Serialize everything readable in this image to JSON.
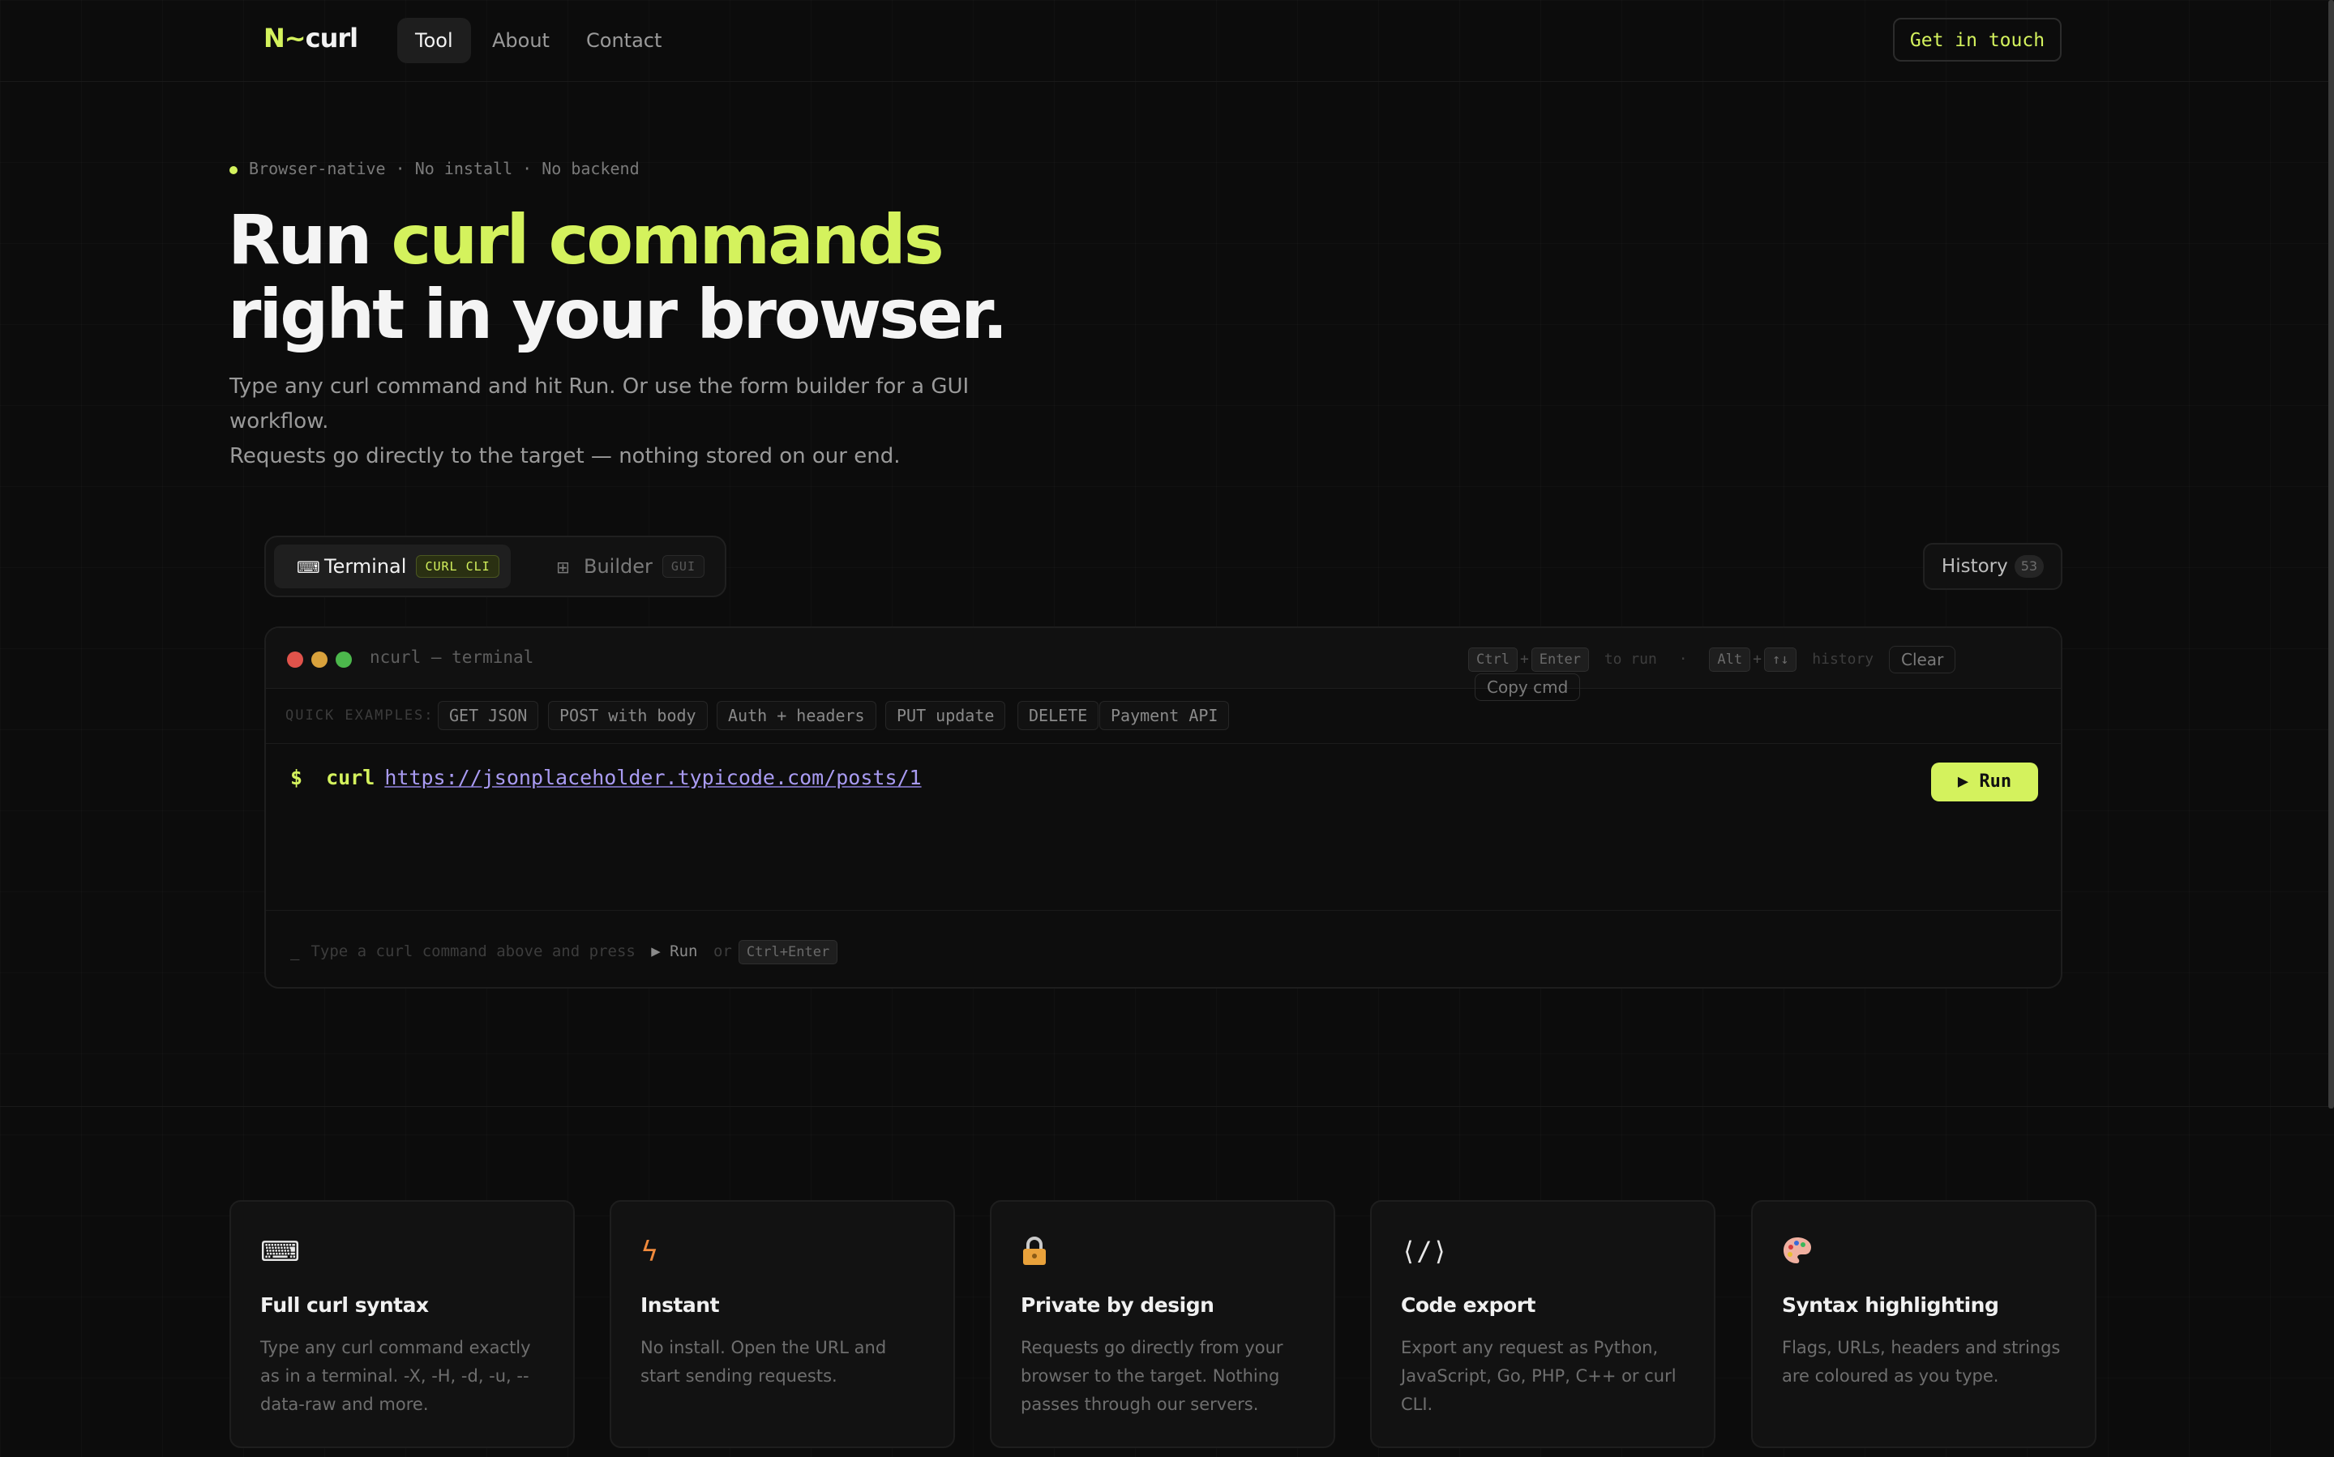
{
  "nav": {
    "logo_prefix": "N~",
    "logo_text": "curl",
    "links": [
      "Tool",
      "About",
      "Contact"
    ],
    "cta": "Get in touch"
  },
  "hero": {
    "tagline": "Browser-native · No install · No backend",
    "title_part1": "Run ",
    "title_highlight": "curl commands",
    "title_part2": "right in your browser.",
    "lead_line1": "Type any curl command and hit Run. Or use the form builder for a GUI workflow.",
    "lead_line2": "Requests go directly to the target — nothing stored on our end."
  },
  "tool": {
    "tabs": [
      {
        "label": "Terminal",
        "badge": "CURL CLI",
        "icon": "keyboard-icon"
      },
      {
        "label": "Builder",
        "badge": "GUI",
        "icon": "grid-icon"
      }
    ],
    "history_label": "History",
    "history_count": "53",
    "terminal": {
      "title": "ncurl — terminal",
      "hint_ctrl": "Ctrl",
      "hint_enter": "Enter",
      "hint_run": "to run",
      "hint_dot": "·",
      "hint_alt": "Alt",
      "hint_arrows": "↑↓",
      "hint_history": "history",
      "clear": "Clear",
      "copy": "Copy cmd",
      "examples_label": "QUICK EXAMPLES:",
      "examples": [
        "GET JSON",
        "POST with body",
        "Auth + headers",
        "PUT update",
        "DELETE",
        "Payment API"
      ],
      "prompt_symbol": "$",
      "command": "curl",
      "url": "https://jsonplaceholder.typicode.com/posts/1",
      "run_label": "▶ Run",
      "footer_cursor": "_",
      "footer_text": "Type a curl command above and press",
      "footer_run": "▶ Run",
      "footer_or": "or",
      "footer_kbd": "Ctrl+Enter"
    }
  },
  "features": [
    {
      "icon": "keyboard-icon",
      "title": "Full curl syntax",
      "desc": "Type any curl command exactly as in a terminal. -X, -H, -d, -u, --data-raw and more."
    },
    {
      "icon": "lightning-icon",
      "title": "Instant",
      "desc": "No install. Open the URL and start sending requests."
    },
    {
      "icon": "lock-icon",
      "title": "Private by design",
      "desc": "Requests go directly from your browser to the target. Nothing passes through our servers."
    },
    {
      "icon": "code-icon",
      "title": "Code export",
      "desc": "Export any request as Python, JavaScript, Go, PHP, C++ or curl CLI."
    },
    {
      "icon": "palette-icon",
      "title": "Syntax highlighting",
      "desc": "Flags, URLs, headers and strings are coloured as you type."
    }
  ],
  "colors": {
    "accent": "#d4f25d",
    "background": "#0c0c0c",
    "url": "#a99bf2"
  }
}
